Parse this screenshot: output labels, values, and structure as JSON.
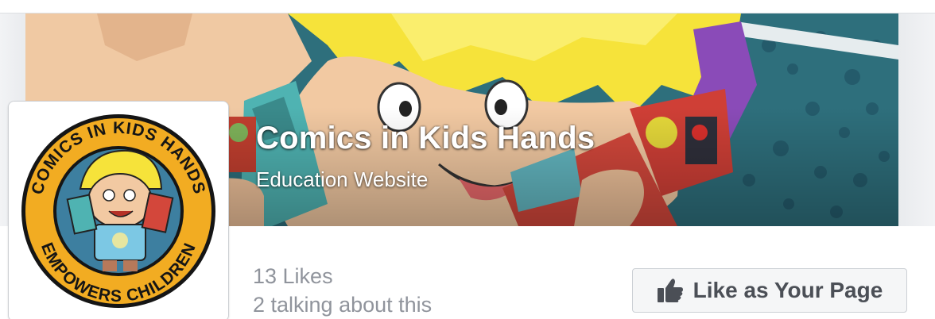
{
  "page": {
    "title": "Comics in Kids Hands",
    "category": "Education Website"
  },
  "profile_logo": {
    "text_top": "COMICS IN KIDS HANDS",
    "text_bottom": "EMPOWERS CHILDREN"
  },
  "stats": {
    "likes": "13 Likes",
    "talking": "2 talking about this"
  },
  "like_button": {
    "label": "Like as Your Page",
    "icon": "thumbs-up-icon"
  },
  "colors": {
    "cover_teal": "#2e6f7c",
    "hair_yellow": "#f6e33a",
    "logo_ring": "#f0a91e",
    "text_grey": "#90949c",
    "button_text": "#4b4f56"
  }
}
